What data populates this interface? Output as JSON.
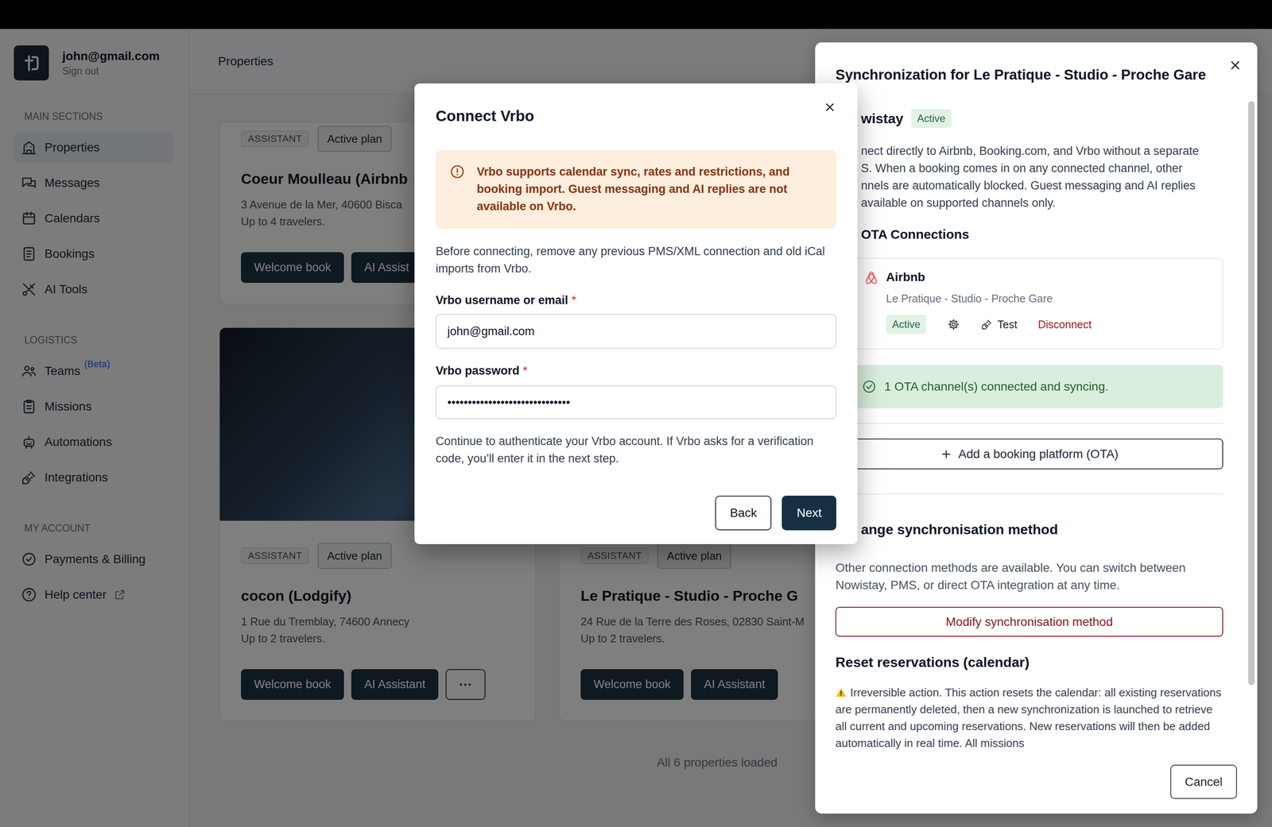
{
  "sidebar": {
    "account": {
      "email": "john@gmail.com",
      "action": "Sign out"
    },
    "sections": [
      {
        "title": "MAIN SECTIONS",
        "items": [
          {
            "label": "Properties",
            "selected": true
          },
          {
            "label": "Messages",
            "selected": false
          },
          {
            "label": "Calendars",
            "selected": false
          },
          {
            "label": "Bookings",
            "selected": false
          },
          {
            "label": "AI Tools",
            "selected": false
          }
        ]
      },
      {
        "title": "LOGISTICS",
        "items": [
          {
            "label": "Teams",
            "selected": false,
            "badge": "(Beta)"
          },
          {
            "label": "Missions",
            "selected": false
          },
          {
            "label": "Automations",
            "selected": false
          },
          {
            "label": "Integrations",
            "selected": false
          }
        ]
      },
      {
        "title": "MY ACCOUNT",
        "items": [
          {
            "label": "Payments & Billing",
            "selected": false
          },
          {
            "label": "Help center",
            "selected": false
          }
        ]
      }
    ]
  },
  "main": {
    "header": "Properties",
    "cards": [
      {
        "photo": false,
        "tags": [
          "ASSISTANT",
          "Active plan"
        ],
        "title": "Coeur Moulleau (Airbnb",
        "address": "3 Avenue de la Mer, 40600 Bisca",
        "capacity": "Up to 4 travelers.",
        "actions": [
          "Welcome book",
          "AI Assist"
        ]
      },
      {
        "photo": true,
        "tags": [
          "ASSISTANT",
          "Active plan"
        ],
        "title": "cocon (Lodgify)",
        "address": "1 Rue du Tremblay, 74600 Annecy",
        "capacity": "Up to 2 travelers.",
        "actions": [
          "Welcome book",
          "AI Assistant"
        ],
        "more": "···"
      },
      {
        "photo": true,
        "tags": [
          "ASSISTANT",
          "Active plan"
        ],
        "title": "Le Pratique - Studio - Proche G",
        "address": "24 Rue de la Terre des Roses, 02830 Saint-M",
        "capacity": "Up to 2 travelers.",
        "actions": [
          "Welcome book",
          "AI Assistant"
        ]
      }
    ],
    "footer": "All 6 properties loaded"
  },
  "drawer": {
    "title": "Synchronization for Le Pratique - Studio - Proche Gare",
    "provider": {
      "name": "wistay",
      "status": "Active"
    },
    "description": [
      "nect directly to Airbnb, Booking.com, and Vrbo without a separate",
      "S. When a booking comes in on any connected channel, other",
      "nnels are automatically blocked. Guest messaging and AI replies",
      "available on supported channels only."
    ],
    "connections_title": "OTA Connections",
    "connections": [
      {
        "name": "Airbnb",
        "listing": "Le Pratique - Studio - Proche Gare",
        "status": "Active",
        "test": "Test",
        "disconnect": "Disconnect"
      }
    ],
    "summary": "1 OTA channel(s) connected and syncing.",
    "add_button": "Add a booking platform (OTA)",
    "method": {
      "title": "ange synchronisation method",
      "text": "Other connection methods are available. You can switch between Nowistay, PMS, or direct OTA integration at any time.",
      "button": "Modify synchronisation method"
    },
    "reset": {
      "title": "Reset reservations (calendar)",
      "text": "Irreversible action. This action resets the calendar: all existing reservations are permanently deleted, then a new synchronization is launched to retrieve all current and upcoming reservations. New reservations will then be added automatically in real time. All missions"
    },
    "footer_button": "Cancel"
  },
  "modal": {
    "title": "Connect Vrbo",
    "notice": "Vrbo supports calendar sync, rates and restrictions, and booking import. Guest messaging and AI replies are not available on Vrbo.",
    "intro": "Before connecting, remove any previous PMS/XML connection and old iCal imports from Vrbo.",
    "fields": [
      {
        "label": "Vrbo username or email",
        "marker": "*",
        "value": "john@gmail.com"
      },
      {
        "label": "Vrbo password",
        "marker": "*",
        "value": "••••••••••••••••••••••••••••••"
      }
    ],
    "hint": "Continue to authenticate your Vrbo account. If Vrbo asks for a verification code, you’ll enter it in the next step.",
    "buttons": [
      {
        "label": "Back",
        "primary": false
      },
      {
        "label": "Next",
        "primary": true
      }
    ]
  }
}
